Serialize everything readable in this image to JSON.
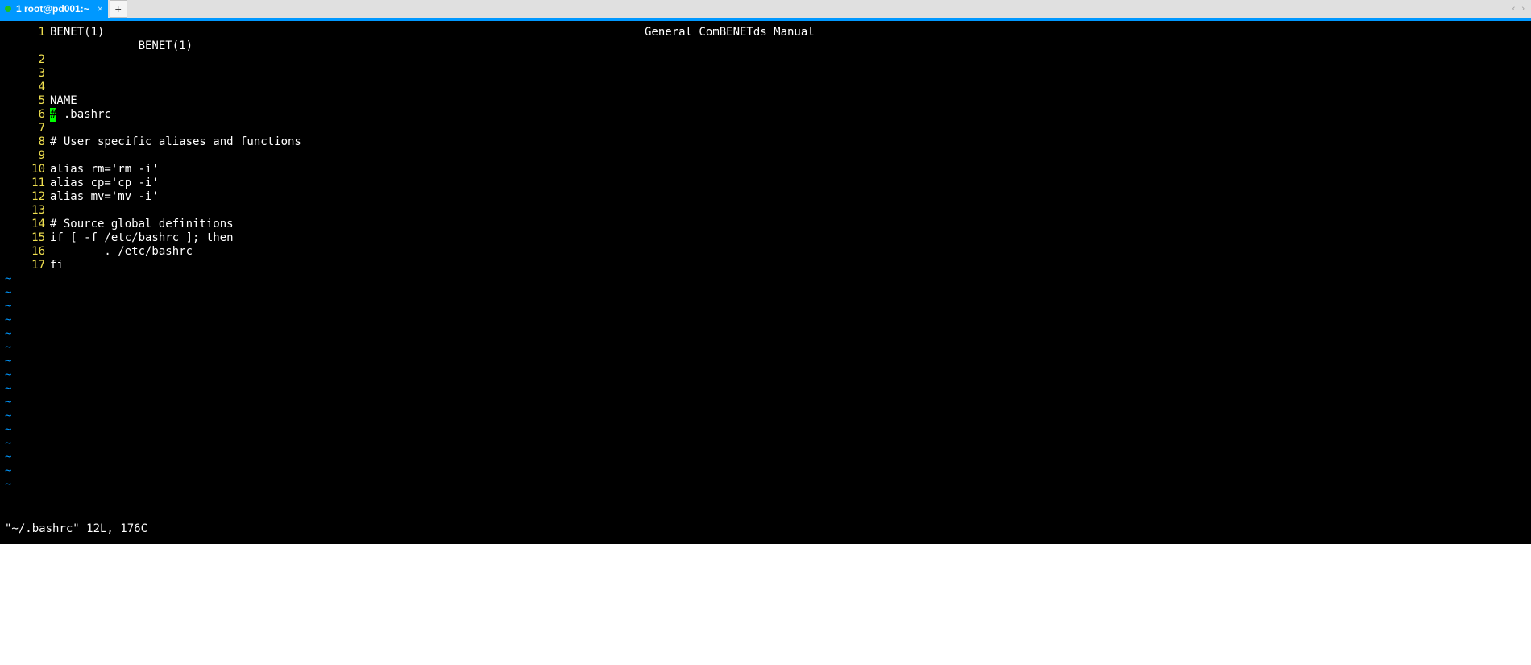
{
  "window": {
    "tab_label": "1 root@pd001:~",
    "tab_close_glyph": "×",
    "new_tab_glyph": "+",
    "nav_left": "‹",
    "nav_right": "›"
  },
  "editor": {
    "header_left": "BENET(1)",
    "header_center": "General ComBENETds Manual",
    "header_wrap": "BENET(1)",
    "cursor_char": "#",
    "lines": [
      {
        "n": "1",
        "text_before_cursor": "",
        "text_after_cursor": "BENET(1)"
      },
      {
        "n": "2",
        "text_before_cursor": "",
        "text_after_cursor": ""
      },
      {
        "n": "3",
        "text_before_cursor": "",
        "text_after_cursor": ""
      },
      {
        "n": "4",
        "text_before_cursor": "",
        "text_after_cursor": ""
      },
      {
        "n": "5",
        "text_before_cursor": "",
        "text_after_cursor": "NAME"
      },
      {
        "n": "6",
        "text_before_cursor": "",
        "text_after_cursor": " .bashrc",
        "has_cursor": true
      },
      {
        "n": "7",
        "text_before_cursor": "",
        "text_after_cursor": ""
      },
      {
        "n": "8",
        "text_before_cursor": "",
        "text_after_cursor": "# User specific aliases and functions"
      },
      {
        "n": "9",
        "text_before_cursor": "",
        "text_after_cursor": ""
      },
      {
        "n": "10",
        "text_before_cursor": "",
        "text_after_cursor": "alias rm='rm -i'"
      },
      {
        "n": "11",
        "text_before_cursor": "",
        "text_after_cursor": "alias cp='cp -i'"
      },
      {
        "n": "12",
        "text_before_cursor": "",
        "text_after_cursor": "alias mv='mv -i'"
      },
      {
        "n": "13",
        "text_before_cursor": "",
        "text_after_cursor": ""
      },
      {
        "n": "14",
        "text_before_cursor": "",
        "text_after_cursor": "# Source global definitions"
      },
      {
        "n": "15",
        "text_before_cursor": "",
        "text_after_cursor": "if [ -f /etc/bashrc ]; then"
      },
      {
        "n": "16",
        "text_before_cursor": "",
        "text_after_cursor": "        . /etc/bashrc"
      },
      {
        "n": "17",
        "text_before_cursor": "",
        "text_after_cursor": "fi"
      }
    ],
    "tilde": "~",
    "tilde_count": 16,
    "status": "\"~/.bashrc\" 12L, 176C"
  }
}
